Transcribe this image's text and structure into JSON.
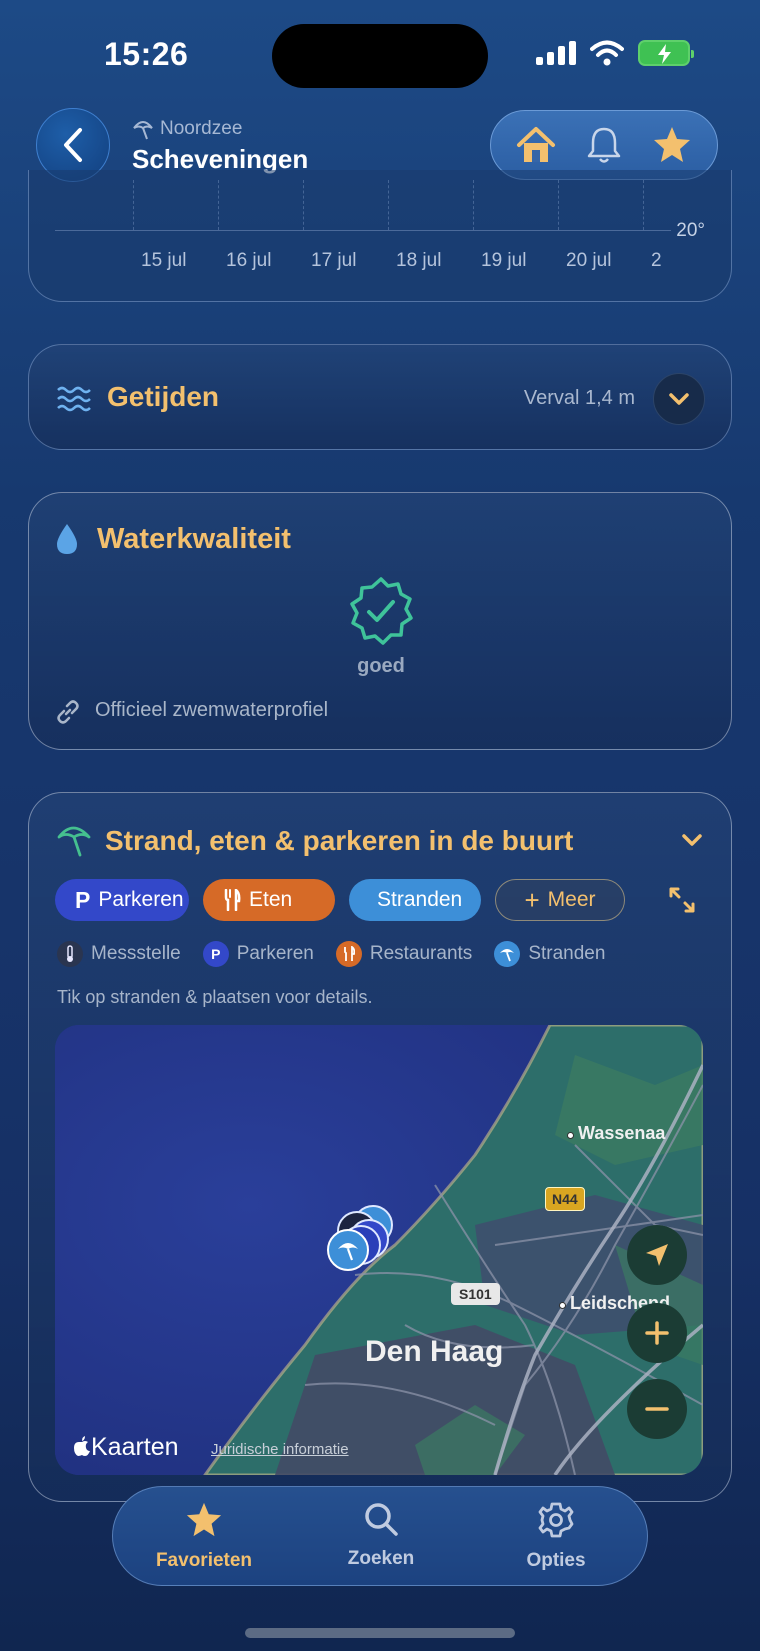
{
  "status_bar": {
    "time": "15:26"
  },
  "header": {
    "region": "Noordzee",
    "title": "Scheveningen"
  },
  "forecast": {
    "temp_label": "20°",
    "dates": [
      "15 jul",
      "16 jul",
      "17 jul",
      "18 jul",
      "19 jul",
      "20 jul",
      "2"
    ]
  },
  "tides": {
    "title": "Getijden",
    "meta": "Verval 1,4 m"
  },
  "water_quality": {
    "title": "Waterkwaliteit",
    "status": "goed",
    "link": "Officieel zwemwaterprofiel"
  },
  "nearby": {
    "title": "Strand, eten & parkeren in de buurt",
    "chips": {
      "parking": "Parkeren",
      "eat": "Eten",
      "beaches": "Stranden",
      "more": "Meer"
    },
    "legend": {
      "station": "Messstelle",
      "parking": "Parkeren",
      "restaurants": "Restaurants",
      "beaches": "Stranden"
    },
    "hint": "Tik op stranden & plaatsen voor details.",
    "map": {
      "city": "Den Haag",
      "place1": "Wassenaa",
      "place2": "Leidschend",
      "road1": "N44",
      "road2": "S101",
      "brand": "Kaarten",
      "legal": "Juridische informatie"
    }
  },
  "tabbar": {
    "favorites": "Favorieten",
    "search": "Zoeken",
    "options": "Opties"
  },
  "colors": {
    "accent": "#f3c06e",
    "parking": "#3348c9",
    "eat": "#d66a27",
    "beaches": "#3d8fd8",
    "good": "#3fc39a"
  }
}
